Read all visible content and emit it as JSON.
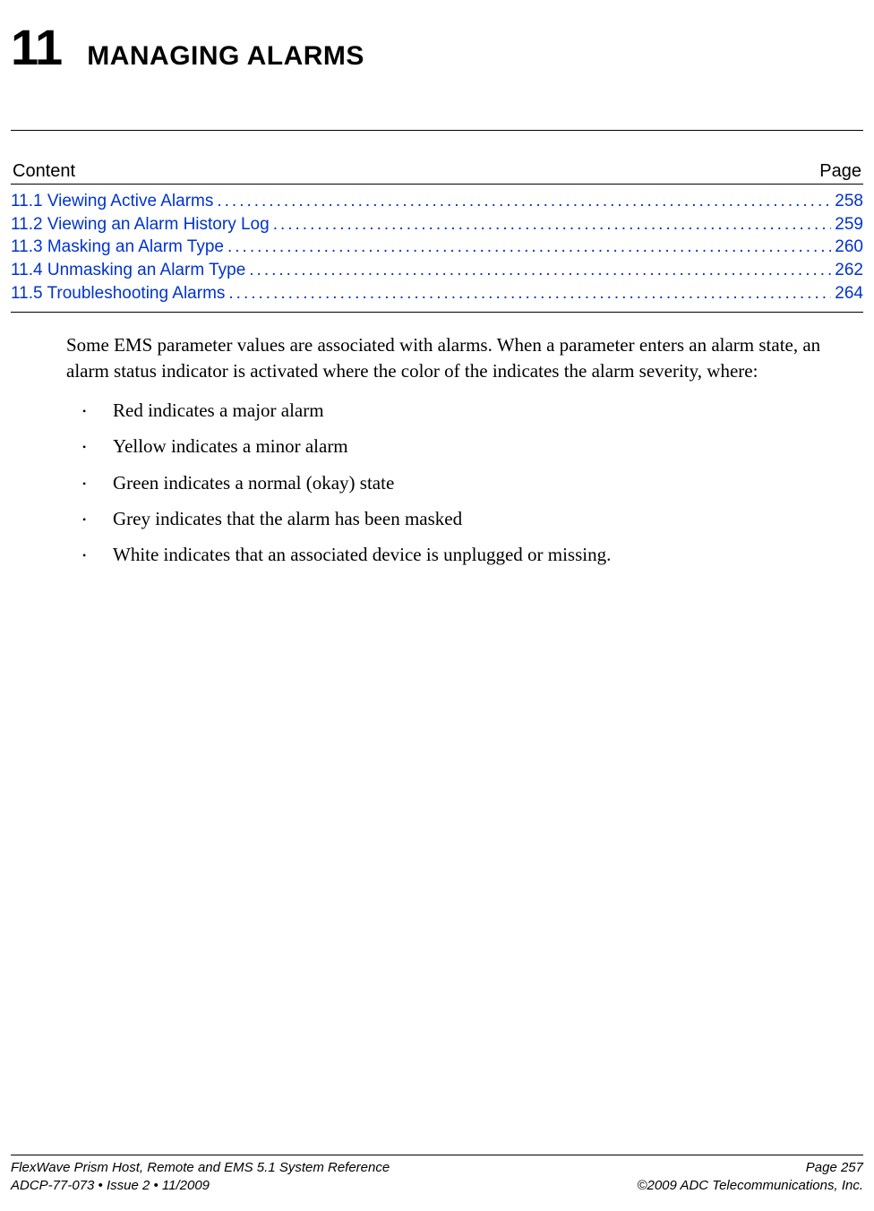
{
  "chapter": {
    "number": "11",
    "title": "MANAGING ALARMS"
  },
  "toc": {
    "content_label": "Content",
    "page_label": "Page",
    "items": [
      {
        "label": "11.1 Viewing Active Alarms",
        "page": "258"
      },
      {
        "label": "11.2 Viewing an Alarm History Log",
        "page": "259"
      },
      {
        "label": "11.3 Masking an Alarm Type",
        "page": "260"
      },
      {
        "label": "11.4 Unmasking an Alarm Type",
        "page": "262"
      },
      {
        "label": "11.5 Troubleshooting Alarms",
        "page": "264"
      }
    ]
  },
  "intro": "Some EMS parameter values are associated with alarms. When a parameter enters an alarm state, an alarm status indicator is activated where the color of the indicates the alarm severity, where:",
  "bullets": [
    "Red indicates a major alarm",
    "Yellow indicates a minor alarm",
    "Green indicates a normal (okay) state",
    "Grey indicates that the alarm has been masked",
    "White indicates that an associated device is unplugged or missing."
  ],
  "footer": {
    "left1": "FlexWave Prism Host, Remote and EMS 5.1 System Reference",
    "left2": "ADCP-77-073  •  Issue 2  •  11/2009",
    "right1": "Page 257",
    "right2": "©2009 ADC Telecommunications, Inc."
  }
}
